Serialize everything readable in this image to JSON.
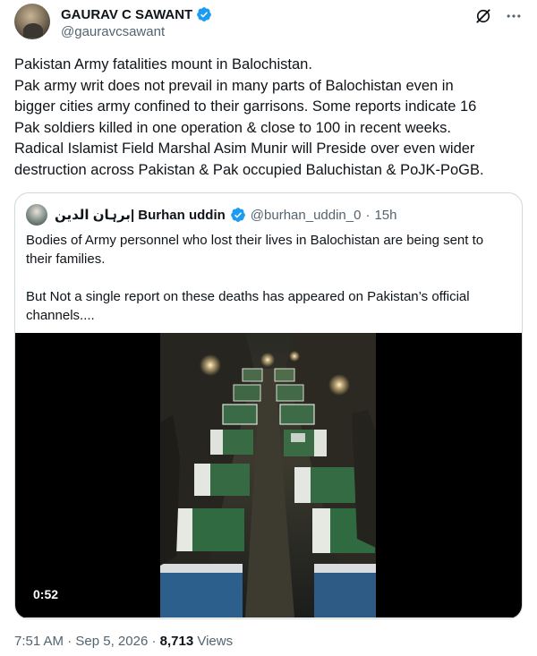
{
  "author": {
    "display_name": "GAURAV C SAWANT",
    "handle": "@gauravcsawant",
    "verified": true
  },
  "header_icons": [
    "grok-icon",
    "more-icon"
  ],
  "tweet": {
    "lines": [
      "Pakistan Army fatalities mount in Balochistan.",
      "Pak army writ does not prevail in many parts of Balochistan even in",
      "bigger cities army confined to their garrisons. Some reports indicate 16",
      "Pak soldiers killed in one operation & close to 100 in recent weeks.",
      "Radical Islamist Field Marshal Asim Munir will Preside over even wider",
      "destruction across Pakistan & Pak occupied Baluchistan & PoJK-PoGB."
    ]
  },
  "quoted": {
    "display_name": "برہان الدین| Burhan uddin",
    "handle": "@burhan_uddin_0",
    "separator": "·",
    "time": "15h",
    "verified": true,
    "text": {
      "p1": "Bodies of Army personnel who lost their lives in Balochistan are being sent to their families.",
      "p2": "But Not a single report on these deaths has appeared on Pakistan’s official channels...."
    },
    "video": {
      "duration": "0:52"
    }
  },
  "footer": {
    "time": "7:51 AM",
    "separator": "·",
    "date": "Sep 5, 2026",
    "views_count": "8,713",
    "views_label": "Views"
  },
  "colors": {
    "text": "#0f1419",
    "secondary": "#536471",
    "verified": "#1d9bf0",
    "border": "#cfd9de"
  }
}
